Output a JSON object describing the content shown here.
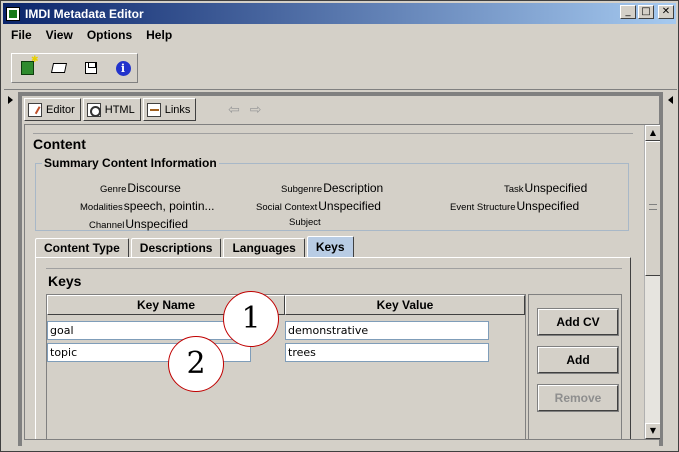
{
  "window": {
    "title": "IMDI Metadata Editor",
    "controls": [
      "_",
      "□",
      "✕"
    ]
  },
  "menubar": {
    "items": [
      "File",
      "View",
      "Options",
      "Help"
    ]
  },
  "toolbar": {
    "icons": [
      "new-icon",
      "open-icon",
      "save-icon",
      "info-icon"
    ]
  },
  "view_tabs": {
    "editor": "Editor",
    "html": "HTML",
    "links": "Links",
    "back_arrow": "⇦",
    "forward_arrow": "⇨"
  },
  "content": {
    "section_title": "Content",
    "summary_title": "Summary Content Information",
    "fields": {
      "genre_label": "Genre",
      "genre_value": "Discourse",
      "subgenre_label": "Subgenre",
      "subgenre_value": "Description",
      "task_label": "Task",
      "task_value": "Unspecified",
      "modalities_label": "Modalities",
      "modalities_value": "speech, pointin...",
      "social_context_label": "Social Context",
      "social_context_value": "Unspecified",
      "event_structure_label": "Event Structure",
      "event_structure_value": "Unspecified",
      "channel_label": "Channel",
      "channel_value": "Unspecified",
      "subject_label": "Subject",
      "subject_value": ""
    }
  },
  "inner_tabs": [
    "Content Type",
    "Descriptions",
    "Languages",
    "Keys"
  ],
  "active_inner_tab": "Keys",
  "keys": {
    "title": "Keys",
    "columns": [
      "Key Name",
      "Key Value"
    ],
    "rows": [
      {
        "name": "goal",
        "value": "demonstrative"
      },
      {
        "name": "topic",
        "value": "trees"
      }
    ],
    "buttons": {
      "add_cv": "Add CV",
      "add": "Add",
      "remove": "Remove"
    }
  },
  "callouts": [
    "1",
    "2"
  ]
}
